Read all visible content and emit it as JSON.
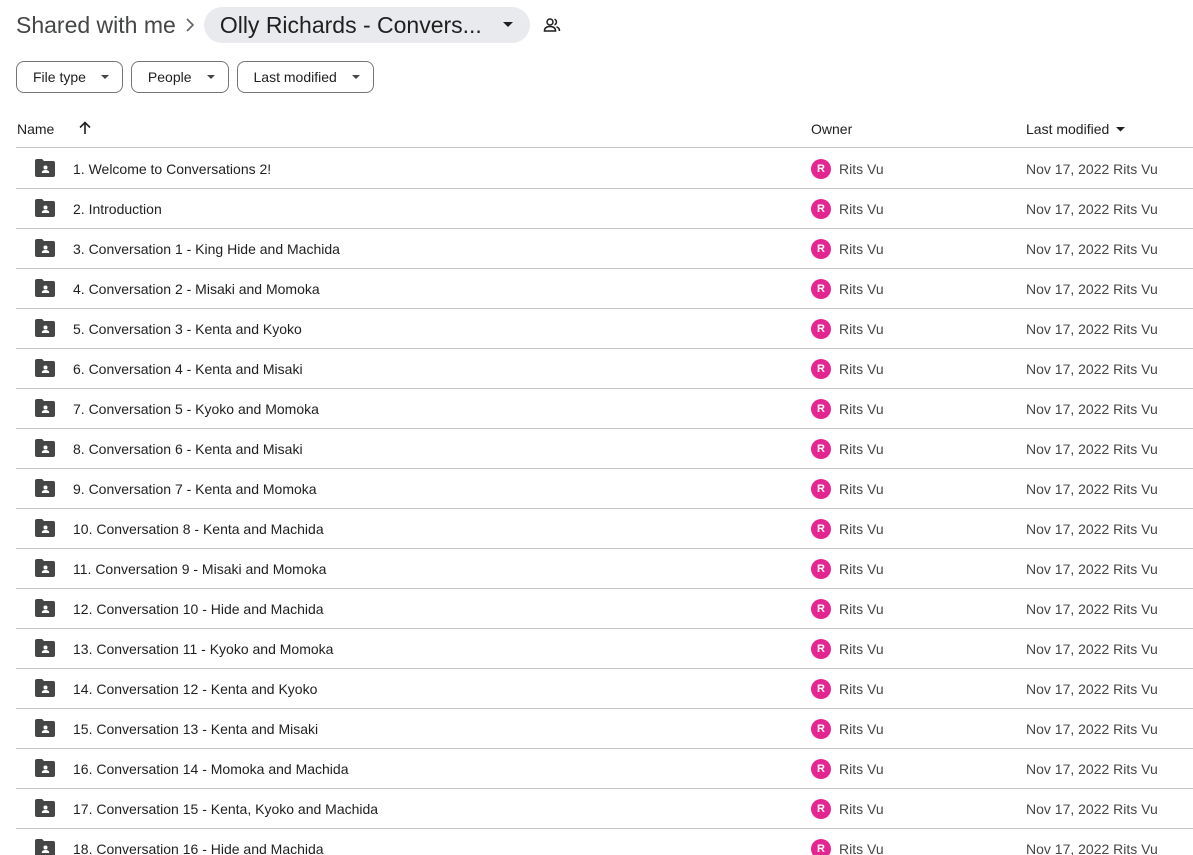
{
  "breadcrumb": {
    "root_label": "Shared with me",
    "current_label": "Olly Richards - Convers..."
  },
  "filters": [
    {
      "label": "File type"
    },
    {
      "label": "People"
    },
    {
      "label": "Last modified"
    }
  ],
  "table": {
    "headers": {
      "name": "Name",
      "owner": "Owner",
      "last_modified": "Last modified"
    },
    "rows": [
      {
        "name": "1. Welcome to Conversations 2!",
        "owner_initial": "R",
        "owner": "Rits Vu",
        "modified": "Nov 17, 2022 Rits Vu"
      },
      {
        "name": "2. Introduction",
        "owner_initial": "R",
        "owner": "Rits Vu",
        "modified": "Nov 17, 2022 Rits Vu"
      },
      {
        "name": "3. Conversation 1 - King Hide and Machida",
        "owner_initial": "R",
        "owner": "Rits Vu",
        "modified": "Nov 17, 2022 Rits Vu"
      },
      {
        "name": "4. Conversation 2 - Misaki and Momoka",
        "owner_initial": "R",
        "owner": "Rits Vu",
        "modified": "Nov 17, 2022 Rits Vu"
      },
      {
        "name": "5. Conversation 3 - Kenta and Kyoko",
        "owner_initial": "R",
        "owner": "Rits Vu",
        "modified": "Nov 17, 2022 Rits Vu"
      },
      {
        "name": "6. Conversation 4 - Kenta and Misaki",
        "owner_initial": "R",
        "owner": "Rits Vu",
        "modified": "Nov 17, 2022 Rits Vu"
      },
      {
        "name": "7. Conversation 5 - Kyoko and Momoka",
        "owner_initial": "R",
        "owner": "Rits Vu",
        "modified": "Nov 17, 2022 Rits Vu"
      },
      {
        "name": "8. Conversation 6 - Kenta and Misaki",
        "owner_initial": "R",
        "owner": "Rits Vu",
        "modified": "Nov 17, 2022 Rits Vu"
      },
      {
        "name": "9. Conversation 7 - Kenta and Momoka",
        "owner_initial": "R",
        "owner": "Rits Vu",
        "modified": "Nov 17, 2022 Rits Vu"
      },
      {
        "name": "10. Conversation 8 - Kenta and Machida",
        "owner_initial": "R",
        "owner": "Rits Vu",
        "modified": "Nov 17, 2022 Rits Vu"
      },
      {
        "name": "11. Conversation 9 - Misaki and Momoka",
        "owner_initial": "R",
        "owner": "Rits Vu",
        "modified": "Nov 17, 2022 Rits Vu"
      },
      {
        "name": "12. Conversation 10 - Hide and Machida",
        "owner_initial": "R",
        "owner": "Rits Vu",
        "modified": "Nov 17, 2022 Rits Vu"
      },
      {
        "name": "13. Conversation 11 - Kyoko and Momoka",
        "owner_initial": "R",
        "owner": "Rits Vu",
        "modified": "Nov 17, 2022 Rits Vu"
      },
      {
        "name": "14. Conversation 12 - Kenta and Kyoko",
        "owner_initial": "R",
        "owner": "Rits Vu",
        "modified": "Nov 17, 2022 Rits Vu"
      },
      {
        "name": "15. Conversation 13 - Kenta and Misaki",
        "owner_initial": "R",
        "owner": "Rits Vu",
        "modified": "Nov 17, 2022 Rits Vu"
      },
      {
        "name": "16. Conversation 14 - Momoka and Machida",
        "owner_initial": "R",
        "owner": "Rits Vu",
        "modified": "Nov 17, 2022 Rits Vu"
      },
      {
        "name": "17. Conversation 15 - Kenta, Kyoko and Machida",
        "owner_initial": "R",
        "owner": "Rits Vu",
        "modified": "Nov 17, 2022 Rits Vu"
      },
      {
        "name": "18. Conversation 16 - Hide and Machida",
        "owner_initial": "R",
        "owner": "Rits Vu",
        "modified": "Nov 17, 2022 Rits Vu"
      }
    ]
  },
  "icons": {
    "breadcrumb_separator": "chevron-right-icon",
    "breadcrumb_dropdown": "caret-down-icon",
    "shared": "people-icon",
    "sort": "arrow-up-icon",
    "folder": "shared-folder-icon"
  },
  "colors": {
    "avatar": "#e52592",
    "chip_border": "#747775",
    "crumb_bg": "#e8eaed",
    "divider": "#c4c7c5"
  }
}
